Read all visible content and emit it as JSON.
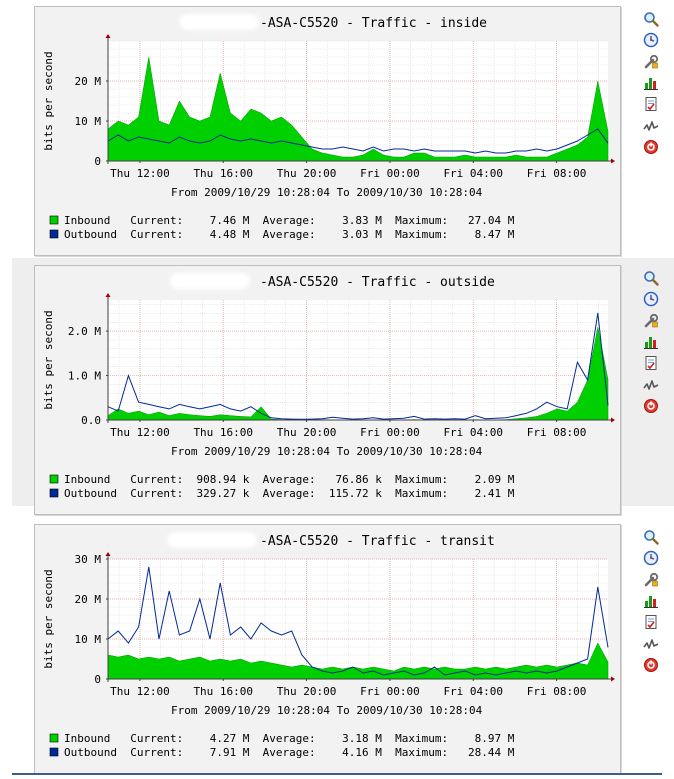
{
  "colors": {
    "inbound": "#00cf00",
    "inbound_edge": "#009900",
    "outbound": "#002a97",
    "grid_minor": "#d8d8d8",
    "grid_major": "#e8a0a0",
    "axis": "#404040",
    "arrow": "#a00000",
    "plot_bg": "#ffffff",
    "panel_bg": "#f2f2f2"
  },
  "icons": [
    "zoom-icon",
    "timeshift-icon",
    "properties-icon",
    "graph-type-icon",
    "report-icon",
    "trend-icon",
    "remove-icon"
  ],
  "watermark": "RRDTOOL / TOBI OETIKER",
  "graphs": [
    {
      "title": "-ASA-C5520 - Traffic - inside",
      "ylabel": "bits per second",
      "range_text": "From 2009/10/29 10:28:04 To 2009/10/30 10:28:04",
      "legend": [
        {
          "name": "Inbound",
          "text": "Inbound   Current:    7.46 M  Average:    3.83 M  Maximum:   27.04 M"
        },
        {
          "name": "Outbound",
          "text": "Outbound  Current:    4.48 M  Average:    3.03 M  Maximum:    8.47 M"
        }
      ]
    },
    {
      "title": "-ASA-C5520 - Traffic - outside",
      "ylabel": "bits per second",
      "range_text": "From 2009/10/29 10:28:04 To 2009/10/30 10:28:04",
      "legend": [
        {
          "name": "Inbound",
          "text": "Inbound   Current:  908.94 k  Average:   76.86 k  Maximum:    2.09 M"
        },
        {
          "name": "Outbound",
          "text": "Outbound  Current:  329.27 k  Average:  115.72 k  Maximum:    2.41 M"
        }
      ]
    },
    {
      "title": "-ASA-C5520 - Traffic - transit",
      "ylabel": "bits per second",
      "range_text": "From 2009/10/29 10:28:04 To 2009/10/30 10:28:04",
      "legend": [
        {
          "name": "Inbound",
          "text": "Inbound   Current:    4.27 M  Average:    3.18 M  Maximum:    8.97 M"
        },
        {
          "name": "Outbound",
          "text": "Outbound  Current:    7.91 M  Average:    4.16 M  Maximum:   28.44 M"
        }
      ]
    }
  ],
  "chart_data": [
    {
      "type": "area",
      "title": "-ASA-C5520 - Traffic - inside",
      "ylabel": "bits per second",
      "x_start_hours": 10.4678,
      "x_end_hours": 34.4678,
      "x_ticks": [
        {
          "hours": 12,
          "label": "Thu 12:00"
        },
        {
          "hours": 16,
          "label": "Thu 16:00"
        },
        {
          "hours": 20,
          "label": "Thu 20:00"
        },
        {
          "hours": 24,
          "label": "Fri 00:00"
        },
        {
          "hours": 28,
          "label": "Fri 04:00"
        },
        {
          "hours": 32,
          "label": "Fri 08:00"
        }
      ],
      "ylim": [
        0,
        30000000
      ],
      "y_ticks": [
        {
          "value": 0,
          "label": "0"
        },
        {
          "value": 10000000,
          "label": "10 M"
        },
        {
          "value": 20000000,
          "label": "20 M"
        }
      ],
      "series": [
        {
          "name": "Inbound",
          "style": "area",
          "values": [
            8000000.0,
            10000000.0,
            9000000.0,
            11000000.0,
            26000000.0,
            10000000.0,
            9000000.0,
            15000000.0,
            11000000.0,
            10000000.0,
            11000000.0,
            22000000.0,
            12000000.0,
            10000000.0,
            13000000.0,
            12000000.0,
            10000000.0,
            11000000.0,
            9000000.0,
            6000000.0,
            3000000.0,
            2000000.0,
            1500000.0,
            1000000.0,
            1000000.0,
            1500000.0,
            3000000.0,
            1500000.0,
            1000000.0,
            1000000.0,
            2000000.0,
            2000000.0,
            1000000.0,
            1000000.0,
            1000000.0,
            1500000.0,
            1000000.0,
            1000000.0,
            1000000.0,
            1000000.0,
            1500000.0,
            1000000.0,
            1000000.0,
            1000000.0,
            2000000.0,
            3000000.0,
            4000000.0,
            6000000.0,
            20000000.0,
            7460000.0
          ]
        },
        {
          "name": "Outbound",
          "style": "line",
          "values": [
            5000000.0,
            6500000.0,
            5000000.0,
            6000000.0,
            5500000.0,
            5000000.0,
            4500000.0,
            6000000.0,
            5000000.0,
            4500000.0,
            5000000.0,
            6500000.0,
            5500000.0,
            5000000.0,
            5500000.0,
            5000000.0,
            4500000.0,
            5000000.0,
            4500000.0,
            4000000.0,
            3500000.0,
            3000000.0,
            3000000.0,
            3500000.0,
            3000000.0,
            2500000.0,
            3500000.0,
            2500000.0,
            3000000.0,
            3000000.0,
            2500000.0,
            3000000.0,
            2500000.0,
            2500000.0,
            2500000.0,
            2500000.0,
            2000000.0,
            2500000.0,
            2000000.0,
            2000000.0,
            2500000.0,
            2500000.0,
            3000000.0,
            2500000.0,
            3000000.0,
            4000000.0,
            5000000.0,
            6500000.0,
            8000000.0,
            4480000.0
          ]
        }
      ]
    },
    {
      "type": "area",
      "title": "-ASA-C5520 - Traffic - outside",
      "ylabel": "bits per second",
      "x_start_hours": 10.4678,
      "x_end_hours": 34.4678,
      "x_ticks": [
        {
          "hours": 12,
          "label": "Thu 12:00"
        },
        {
          "hours": 16,
          "label": "Thu 16:00"
        },
        {
          "hours": 20,
          "label": "Thu 20:00"
        },
        {
          "hours": 24,
          "label": "Fri 00:00"
        },
        {
          "hours": 28,
          "label": "Fri 04:00"
        },
        {
          "hours": 32,
          "label": "Fri 08:00"
        }
      ],
      "ylim": [
        0,
        2700000
      ],
      "y_ticks": [
        {
          "value": 0,
          "label": "0.0"
        },
        {
          "value": 1000000,
          "label": "1.0 M"
        },
        {
          "value": 2000000,
          "label": "2.0 M"
        }
      ],
      "series": [
        {
          "name": "Inbound",
          "style": "area",
          "values": [
            100000,
            250000,
            150000,
            200000,
            120000,
            180000,
            100000,
            150000,
            120000,
            100000,
            80000,
            120000,
            100000,
            80000,
            70000,
            300000,
            20000,
            10000,
            5000,
            5000,
            5000,
            8000,
            5000,
            5000,
            10000,
            5000,
            5000,
            8000,
            5000,
            5000,
            10000,
            5000,
            5000,
            8000,
            5000,
            5000,
            10000,
            5000,
            5000,
            10000,
            30000,
            50000,
            80000,
            150000,
            250000,
            200000,
            400000,
            900000,
            2090000,
            908940
          ]
        },
        {
          "name": "Outbound",
          "style": "line",
          "values": [
            300000,
            200000,
            1000000,
            400000,
            350000,
            300000,
            250000,
            350000,
            300000,
            250000,
            300000,
            350000,
            250000,
            200000,
            300000,
            150000,
            50000,
            30000,
            20000,
            15000,
            20000,
            30000,
            60000,
            40000,
            20000,
            30000,
            50000,
            20000,
            30000,
            40000,
            80000,
            20000,
            30000,
            20000,
            30000,
            20000,
            100000,
            30000,
            40000,
            50000,
            100000,
            150000,
            250000,
            400000,
            300000,
            250000,
            1300000,
            900000,
            2410000,
            329270
          ]
        }
      ]
    },
    {
      "type": "area",
      "title": "-ASA-C5520 - Traffic - transit",
      "ylabel": "bits per second",
      "x_start_hours": 10.4678,
      "x_end_hours": 34.4678,
      "x_ticks": [
        {
          "hours": 12,
          "label": "Thu 12:00"
        },
        {
          "hours": 16,
          "label": "Thu 16:00"
        },
        {
          "hours": 20,
          "label": "Thu 20:00"
        },
        {
          "hours": 24,
          "label": "Fri 00:00"
        },
        {
          "hours": 28,
          "label": "Fri 04:00"
        },
        {
          "hours": 32,
          "label": "Fri 08:00"
        }
      ],
      "ylim": [
        0,
        30000000
      ],
      "y_ticks": [
        {
          "value": 0,
          "label": "0"
        },
        {
          "value": 10000000,
          "label": "10 M"
        },
        {
          "value": 20000000,
          "label": "20 M"
        },
        {
          "value": 30000000,
          "label": "30 M"
        }
      ],
      "series": [
        {
          "name": "Inbound",
          "style": "area",
          "values": [
            6000000.0,
            5500000.0,
            6000000.0,
            5000000.0,
            5500000.0,
            5000000.0,
            5500000.0,
            4500000.0,
            5000000.0,
            5500000.0,
            4500000.0,
            5000000.0,
            4500000.0,
            5000000.0,
            4000000.0,
            4500000.0,
            4000000.0,
            3500000.0,
            3000000.0,
            3500000.0,
            3000000.0,
            2500000.0,
            3000000.0,
            2500000.0,
            3000000.0,
            2500000.0,
            3000000.0,
            2500000.0,
            2000000.0,
            3000000.0,
            2500000.0,
            3000000.0,
            2500000.0,
            3000000.0,
            2500000.0,
            2500000.0,
            3000000.0,
            2500000.0,
            3000000.0,
            2500000.0,
            3000000.0,
            3500000.0,
            3000000.0,
            3500000.0,
            3000000.0,
            3500000.0,
            4000000.0,
            3500000.0,
            8970000.0,
            4270000.0
          ]
        },
        {
          "name": "Outbound",
          "style": "line",
          "values": [
            10000000.0,
            12000000.0,
            9000000.0,
            13000000.0,
            28000000.0,
            10000000.0,
            22000000.0,
            11000000.0,
            12000000.0,
            20000000.0,
            10000000.0,
            24000000.0,
            11000000.0,
            13000000.0,
            10000000.0,
            14000000.0,
            12000000.0,
            11000000.0,
            12000000.0,
            6000000.0,
            3000000.0,
            2000000.0,
            1500000.0,
            2000000.0,
            3000000.0,
            1500000.0,
            2000000.0,
            1000000.0,
            1500000.0,
            2000000.0,
            1000000.0,
            1500000.0,
            3000000.0,
            1000000.0,
            1500000.0,
            2000000.0,
            1000000.0,
            1500000.0,
            1000000.0,
            1500000.0,
            2000000.0,
            1500000.0,
            2000000.0,
            1500000.0,
            2000000.0,
            3000000.0,
            4000000.0,
            5000000.0,
            23000000.0,
            7910000.0
          ]
        }
      ]
    }
  ]
}
